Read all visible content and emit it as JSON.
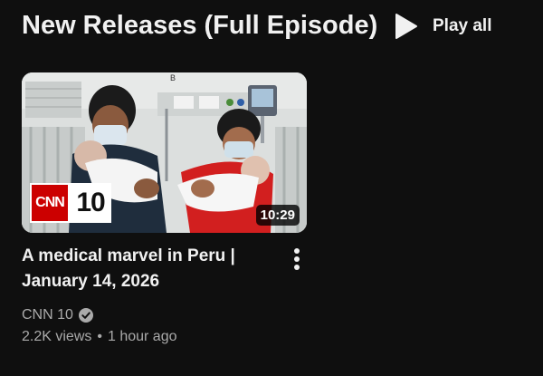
{
  "shelf": {
    "title": "New Releases (Full Episode)",
    "play_all_label": "Play all",
    "play_icon": "play-icon"
  },
  "video": {
    "title": "A medical marvel in Peru | January 14, 2026",
    "duration": "10:29",
    "channel": "CNN 10",
    "views": "2.2K views",
    "separator": "•",
    "age": "1 hour ago",
    "thumbnail_logo": {
      "brand": "CNN",
      "number": "10",
      "brand_color": "#cc0000"
    },
    "wall_letter": "B",
    "menu_icon": "more-vert-icon",
    "verified_icon": "verified-check-icon"
  }
}
